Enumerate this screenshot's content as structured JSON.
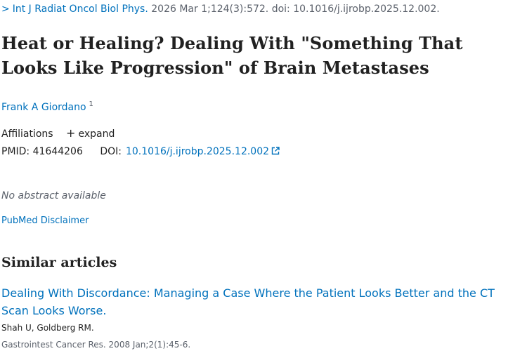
{
  "citation": {
    "journal": "Int J Radiat Oncol Biol Phys.",
    "details": "2026 Mar 1;124(3):572. doi: 10.1016/j.ijrobp.2025.12.002."
  },
  "article": {
    "title": "Heat or Healing? Dealing With \"Something That Looks Like Progression\" of Brain Metastases",
    "author": "Frank A Giordano",
    "author_sup": "1"
  },
  "affiliations": {
    "label": "Affiliations",
    "expand_label": "expand"
  },
  "identifiers": {
    "pmid_label": "PMID:",
    "pmid": "41644206",
    "doi_label": "DOI:",
    "doi": "10.1016/j.ijrobp.2025.12.002"
  },
  "abstract": {
    "no_abstract": "No abstract available"
  },
  "disclaimer_link": "PubMed Disclaimer",
  "similar": {
    "heading": "Similar articles",
    "items": [
      {
        "title": "Dealing With Discordance: Managing a Case Where the Patient Looks Better and the CT Scan Looks Worse.",
        "authors": "Shah U, Goldberg RM.",
        "journal": "Gastrointest Cancer Res. 2008 Jan;2(1):45-6."
      }
    ]
  },
  "colors": {
    "link": "#0071bc",
    "text": "#212121",
    "muted": "#5b616b"
  },
  "icons": {
    "breadcrumb": "chevron-right-icon",
    "expand": "plus-icon",
    "external": "external-link-icon"
  }
}
